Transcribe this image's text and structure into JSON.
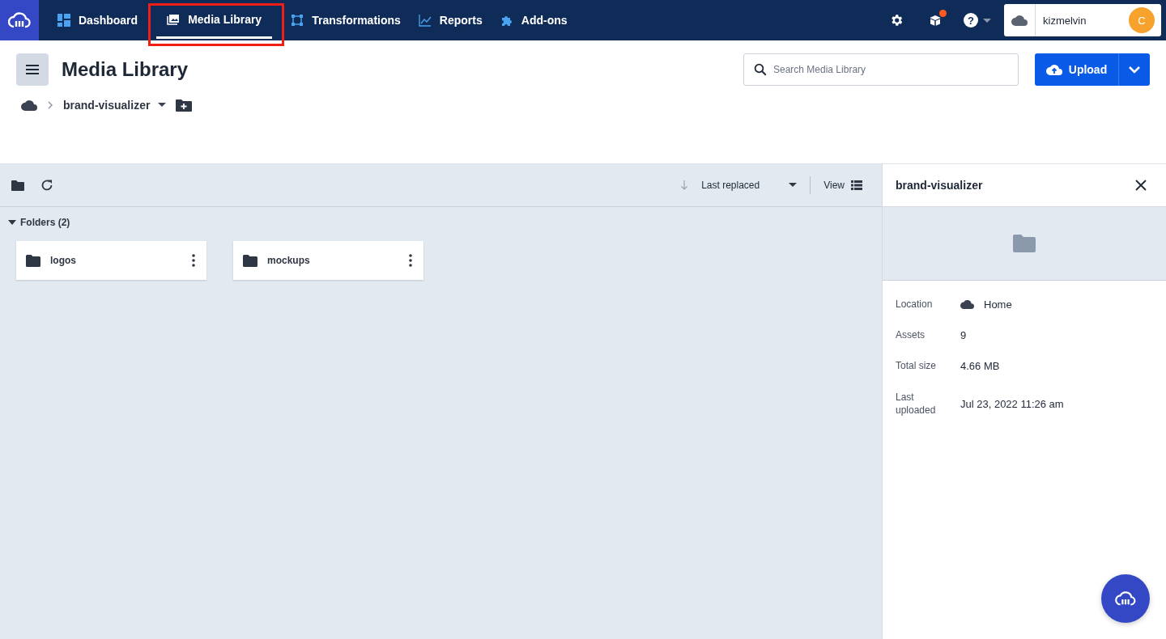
{
  "nav": {
    "items": [
      {
        "label": "Dashboard",
        "selected": false,
        "highlighted": false
      },
      {
        "label": "Media Library",
        "selected": true,
        "highlighted": true
      },
      {
        "label": "Transformations",
        "selected": false,
        "highlighted": false
      },
      {
        "label": "Reports",
        "selected": false,
        "highlighted": false
      },
      {
        "label": "Add-ons",
        "selected": false,
        "highlighted": false
      }
    ],
    "notification": true,
    "help": "?",
    "account": {
      "name": "kizmelvin",
      "avatar": "C"
    }
  },
  "header": {
    "title": "Media Library",
    "search": {
      "placeholder": "Search Media Library"
    },
    "upload_button": "Upload"
  },
  "breadcrumb": {
    "folder": "brand-visualizer"
  },
  "toolbar": {
    "sort": "Last replaced",
    "view": "View"
  },
  "folders": {
    "heading": "Folders (2)",
    "expanded": true,
    "items": [
      {
        "name": "logos"
      },
      {
        "name": "mockups"
      }
    ]
  },
  "details": {
    "title": "brand-visualizer",
    "rows": [
      {
        "label": "Location",
        "value": "Home",
        "kind": "location"
      },
      {
        "label": "Assets",
        "value": "9",
        "kind": "text"
      },
      {
        "label": "Total size",
        "value": "4.66 MB",
        "kind": "text"
      },
      {
        "label": "Last uploaded",
        "value": "Jul 23, 2022 11:26 am",
        "kind": "text"
      }
    ]
  }
}
